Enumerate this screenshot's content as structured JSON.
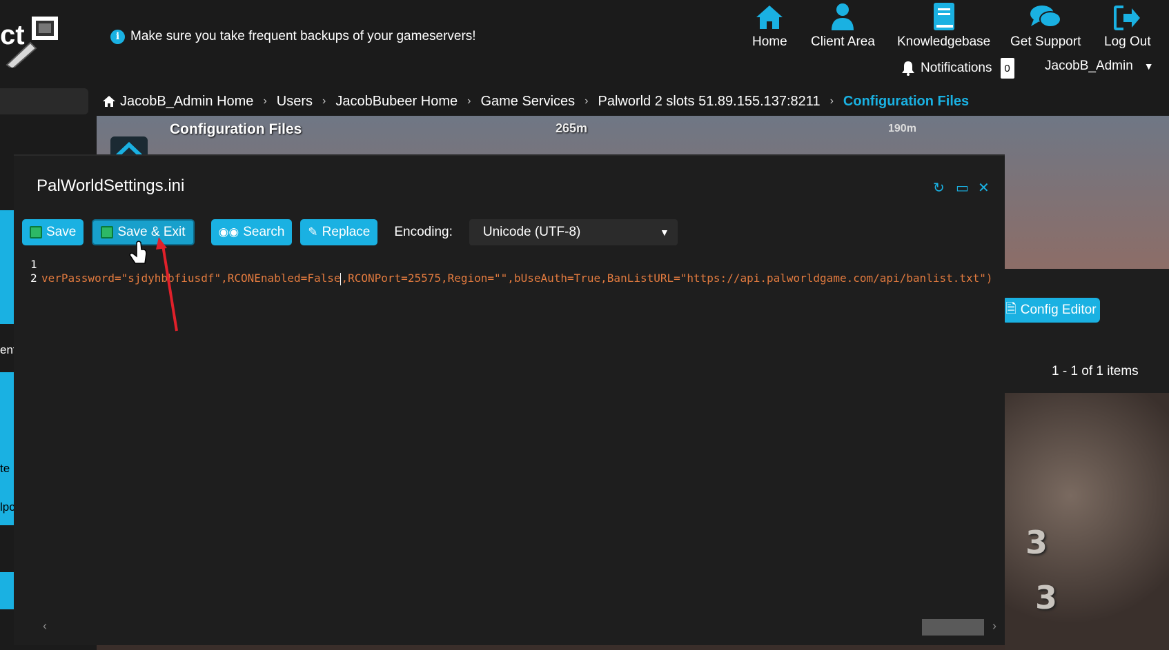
{
  "header": {
    "notice": "Make sure you take frequent backups of your gameservers!",
    "nav": [
      {
        "label": "Home",
        "icon": "home-icon"
      },
      {
        "label": "Client Area",
        "icon": "user-icon"
      },
      {
        "label": "Knowledgebase",
        "icon": "book-icon"
      },
      {
        "label": "Get Support",
        "icon": "chat-icon"
      },
      {
        "label": "Log Out",
        "icon": "logout-icon"
      }
    ],
    "notifications_label": "Notifications",
    "notifications_count": "0",
    "username": "JacobB_Admin"
  },
  "breadcrumb": [
    "JacobB_Admin Home",
    "Users",
    "JacobBubeer Home",
    "Game Services",
    "Palworld 2 slots 51.89.155.137:8211",
    "Configuration Files"
  ],
  "sidebar": {
    "fragments": [
      "ent",
      "te",
      "lpc"
    ]
  },
  "background": {
    "page_heading": "Configuration Files",
    "marker_1": "265m",
    "marker_2": "190m",
    "config_editor_label": "Config Editor",
    "items_text": "1 - 1 of 1 items",
    "numbers": [
      "3",
      "3"
    ]
  },
  "editor": {
    "title": "PalWorldSettings.ini",
    "buttons": {
      "save": "Save",
      "save_exit": "Save & Exit",
      "search": "Search",
      "replace": "Replace"
    },
    "encoding_label": "Encoding:",
    "encoding_value": "Unicode (UTF-8)",
    "line_numbers": [
      "1",
      "2"
    ],
    "line2_before_caret": "verPassword=\"sjdyhbbfiusdf\",RCONEnabled=False",
    "line2_after_caret": ",RCONPort=25575,Region=\"\",bUseAuth=True,BanListURL=\"https://api.palworldgame.com/api/banlist.txt\")"
  },
  "colors": {
    "accent": "#1ab1e2",
    "code_text": "#e37b3f",
    "annotation": "#e0202a"
  }
}
